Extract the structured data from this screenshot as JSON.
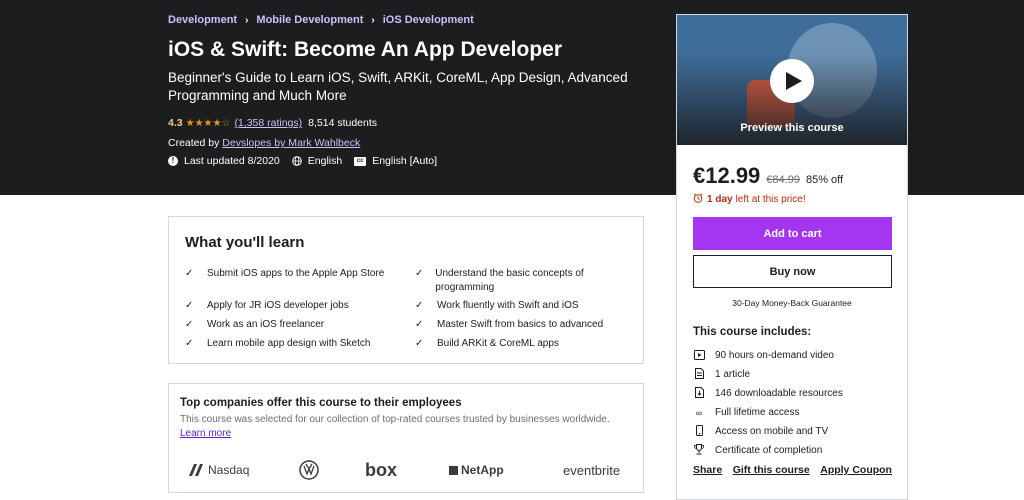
{
  "breadcrumb": [
    "Development",
    "Mobile Development",
    "iOS Development"
  ],
  "breadcrumb_sep": "›",
  "course": {
    "title": "iOS & Swift: Become An App Developer",
    "subtitle": "Beginner's Guide to Learn iOS, Swift, ARKit, CoreML, App Design, Advanced Programming and Much More",
    "rating": "4.3",
    "rating_value": 4.3,
    "rating_max": 5,
    "ratings_count": "(1,358 ratings)",
    "students": "8,514 students",
    "created_by_label": "Created by",
    "authors": "Devslopes by Mark Wahlbeck",
    "last_updated": "Last updated 8/2020",
    "language": "English",
    "captions": "English [Auto]"
  },
  "sidebar": {
    "preview_label": "Preview this course",
    "price": "€12.99",
    "old_price": "€84.99",
    "discount": "85% off",
    "timer_bold": "1 day",
    "timer_rest": "left at this price!",
    "add_to_cart": "Add to cart",
    "buy_now": "Buy now",
    "guarantee": "30-Day Money-Back Guarantee",
    "includes_title": "This course includes:",
    "includes": [
      {
        "icon": "video-icon",
        "text": "90 hours on-demand video"
      },
      {
        "icon": "article-icon",
        "text": "1 article"
      },
      {
        "icon": "download-icon",
        "text": "146 downloadable resources"
      },
      {
        "icon": "infinity-icon",
        "text": "Full lifetime access"
      },
      {
        "icon": "mobile-icon",
        "text": "Access on mobile and TV"
      },
      {
        "icon": "trophy-icon",
        "text": "Certificate of completion"
      }
    ],
    "links": [
      "Share",
      "Gift this course",
      "Apply Coupon"
    ]
  },
  "learn": {
    "title": "What you'll learn",
    "items": [
      "Submit iOS apps to the Apple App Store",
      "Understand the basic concepts of programming",
      "Apply for JR iOS developer jobs",
      "Work fluently with Swift and iOS",
      "Work as an iOS freelancer",
      "Master Swift from basics to advanced",
      "Learn mobile app design with Sketch",
      "Build ARKit & CoreML apps"
    ]
  },
  "companies": {
    "title": "Top companies offer this course to their employees",
    "description": "This course was selected for our collection of top-rated courses trusted by businesses worldwide.",
    "learn_more": "Learn more",
    "logos": [
      "Nasdaq",
      "Volkswagen",
      "box",
      "NetApp",
      "eventbrite"
    ]
  },
  "colors": {
    "hero_bg": "#1c1d1f",
    "accent_purple": "#a435f0",
    "link_light": "#cec0fc",
    "star": "#e59819",
    "timer_red": "#b32d0f"
  }
}
